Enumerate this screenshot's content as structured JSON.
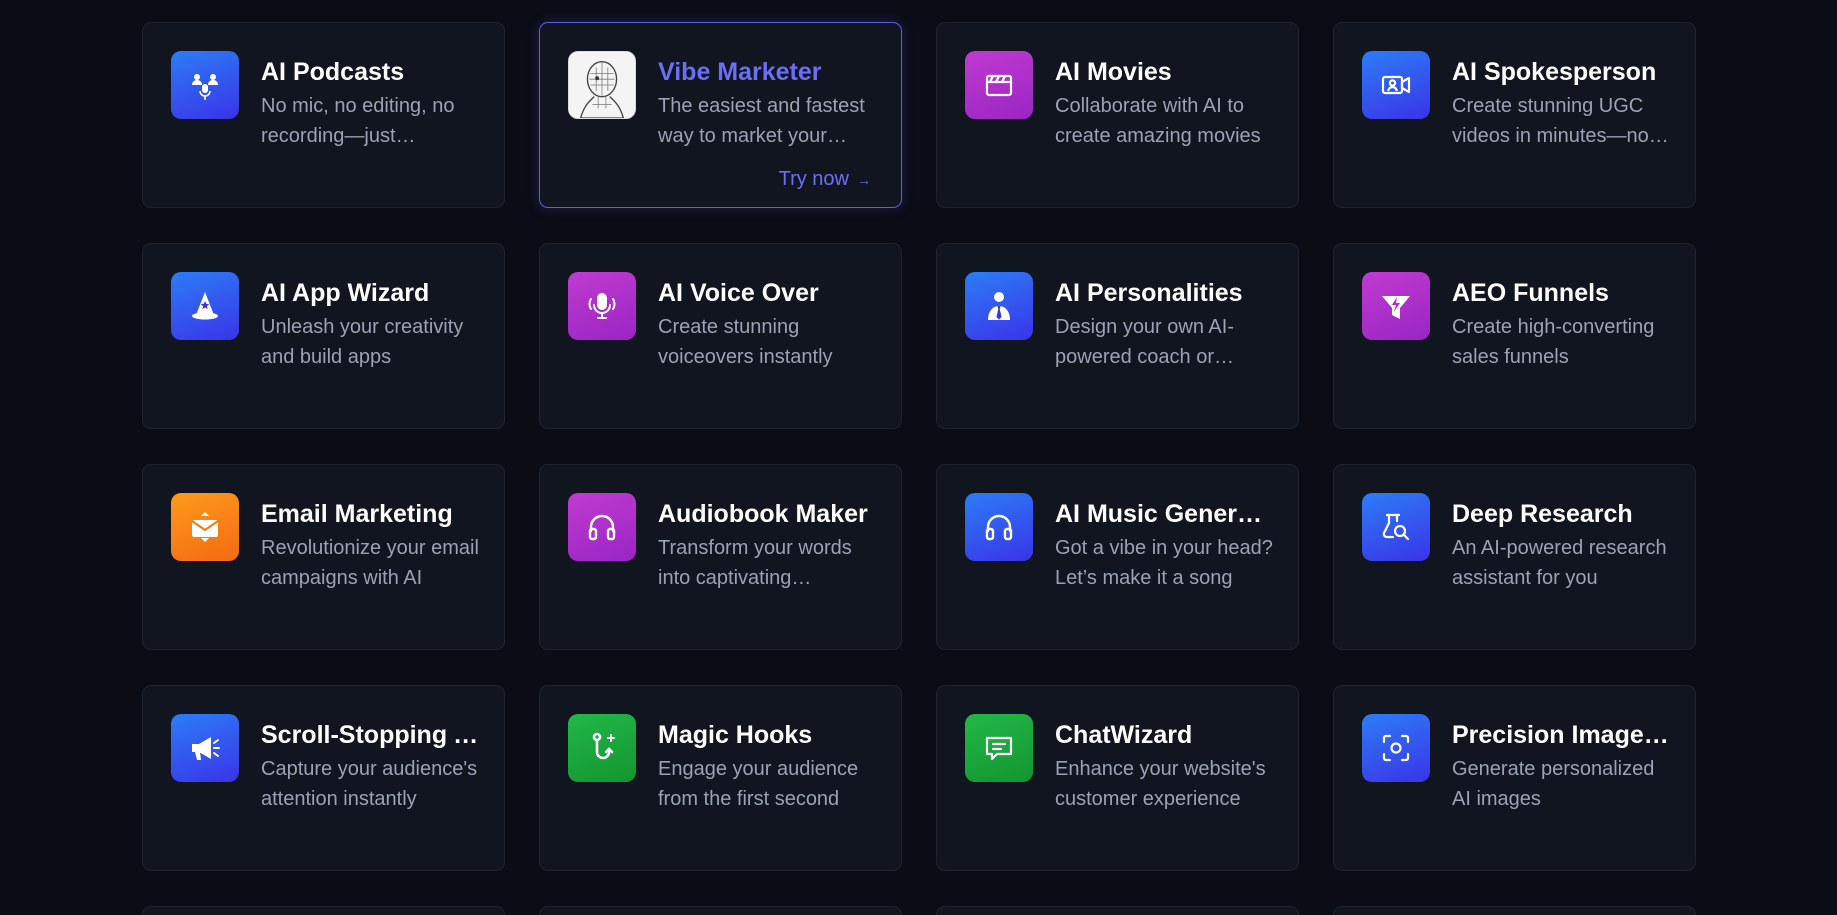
{
  "cards": [
    {
      "title": "AI Podcasts",
      "desc": "No mic, no editing, no recording—just effortless podcasts",
      "icon": "podcast-people-icon"
    },
    {
      "title": "Vibe Marketer",
      "desc": "The easiest and fastest way to market your business",
      "icon": "robot-portrait",
      "cta": "Try now"
    },
    {
      "title": "AI Movies",
      "desc": "Collaborate with AI to create amazing movies",
      "icon": "clapperboard-icon"
    },
    {
      "title": "AI Spokesperson",
      "desc": "Create stunning UGC videos in minutes—no actors needed",
      "icon": "video-avatar-icon"
    },
    {
      "title": "AI App Wizard",
      "desc": "Unleash your creativity and build apps",
      "icon": "wizard-hat-icon"
    },
    {
      "title": "AI Voice Over",
      "desc": "Create stunning voiceovers instantly",
      "icon": "microphone-icon"
    },
    {
      "title": "AI Personalities",
      "desc": "Design your own AI-powered coach or assistant",
      "icon": "person-tie-icon"
    },
    {
      "title": "AEO Funnels",
      "desc": "Create high-converting sales funnels",
      "icon": "funnel-bolt-icon"
    },
    {
      "title": "Email Marketing",
      "desc": "Revolutionize your email campaigns with AI",
      "icon": "envelope-icon"
    },
    {
      "title": "Audiobook Maker",
      "desc": "Transform your words into captivating audiobooks",
      "icon": "headphones-icon"
    },
    {
      "title": "AI Music Generator",
      "desc": "Got a vibe in your head? Let’s make it a song",
      "icon": "headphones-icon"
    },
    {
      "title": "Deep Research",
      "desc": "An AI-powered research assistant for you",
      "icon": "research-flask-icon"
    },
    {
      "title": "Scroll-Stopping Ads",
      "desc": "Capture your audience's attention instantly",
      "icon": "megaphone-icon"
    },
    {
      "title": "Magic Hooks",
      "desc": "Engage your audience from the first second",
      "icon": "hook-sparkle-icon"
    },
    {
      "title": "ChatWizard",
      "desc": "Enhance your website's customer experience",
      "icon": "chat-bubble-icon"
    },
    {
      "title": "Precision Image Editor",
      "desc": "Generate personalized AI images",
      "icon": "focus-scan-icon"
    }
  ],
  "colors": {
    "background": "#0a0d16",
    "card": "#11151f",
    "accent": "#6d6ef7"
  }
}
